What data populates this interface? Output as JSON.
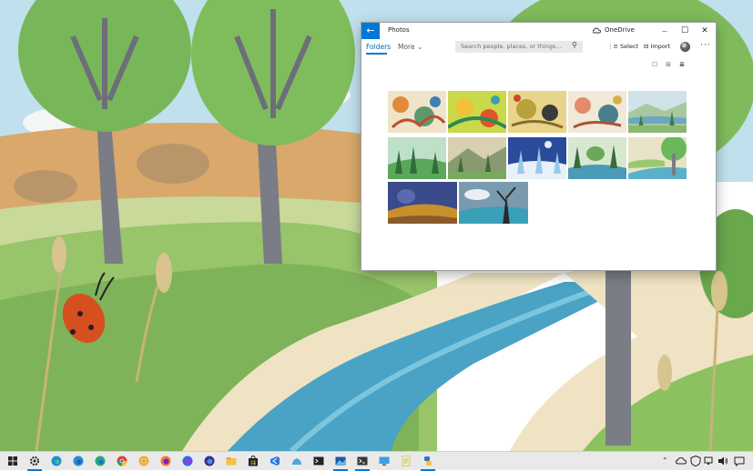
{
  "window": {
    "app_title": "Photos",
    "back_icon": "←",
    "onedrive_label": "OneDrive",
    "minimize_icon": "—",
    "maximize_icon": "☐",
    "close_icon": "✕"
  },
  "toolbar": {
    "folders_tab": "Folders",
    "more_tab": "More ⌄",
    "search_placeholder": "Search people, places, or things...",
    "select_label": "Select",
    "import_label": "Import",
    "more_menu": "···"
  },
  "view_options": {
    "large_icon": "☐",
    "medium_icon": "⊞",
    "list_icon": "≣"
  },
  "photos": [
    {
      "name": "floral-1"
    },
    {
      "name": "floral-2"
    },
    {
      "name": "floral-3"
    },
    {
      "name": "floral-4"
    },
    {
      "name": "lake-forest"
    },
    {
      "name": "green-forest"
    },
    {
      "name": "mountain-forest"
    },
    {
      "name": "winter-forest"
    },
    {
      "name": "river-trees"
    },
    {
      "name": "canal-trees"
    },
    {
      "name": "autumn-hills"
    },
    {
      "name": "winter-tree"
    }
  ],
  "taskbar": {
    "apps": [
      "start",
      "settings",
      "edge",
      "edge-beta",
      "edge-dev",
      "chrome",
      "chrome-canary",
      "firefox",
      "firefox-dev",
      "firefox-nightly",
      "folder",
      "store",
      "visual-studio",
      "azure",
      "terminal",
      "photos",
      "powershell",
      "remote-desktop",
      "notepad",
      "python"
    ],
    "tray_chevron": "⌃"
  },
  "colors": {
    "accent": "#0078d7",
    "taskbar_bg": "#e9e9ea"
  }
}
